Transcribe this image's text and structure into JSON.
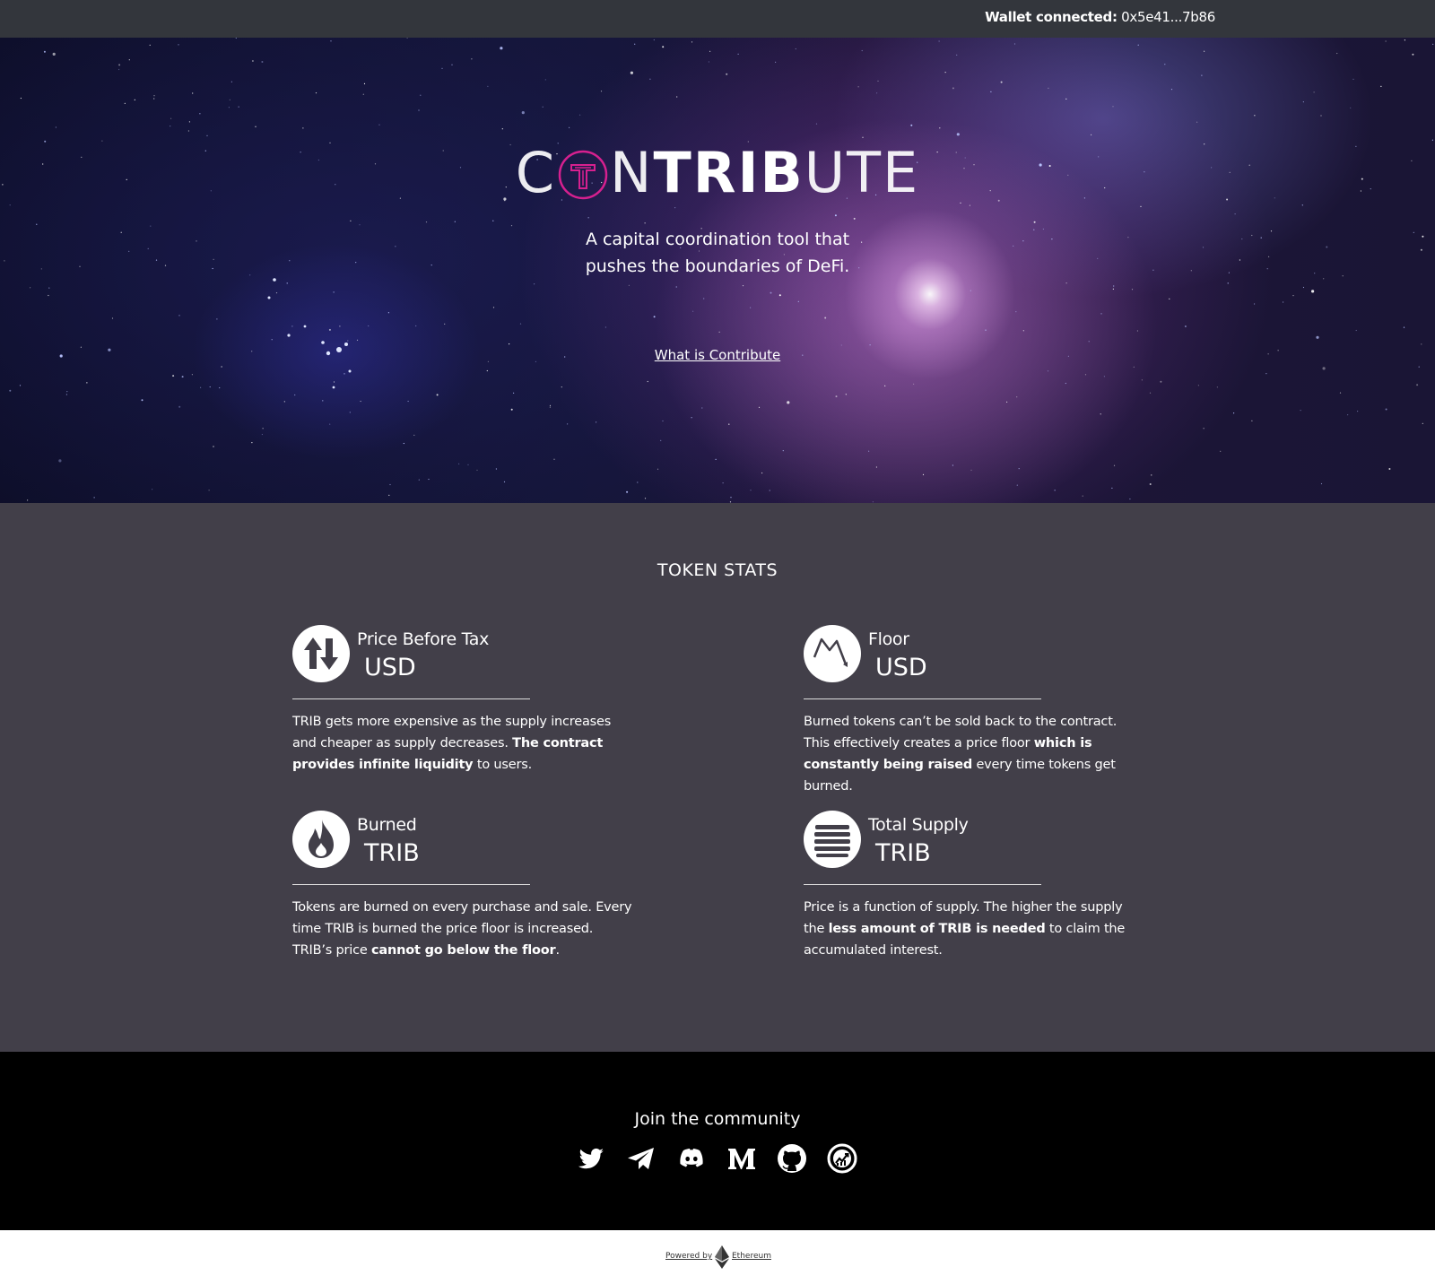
{
  "topbar": {
    "wallet_label": "Wallet connected:",
    "wallet_address": "0x5e41...7b86"
  },
  "hero": {
    "logo_left": "C",
    "logo_mid": "N",
    "logo_bold": "TRIB",
    "logo_right": "UTE",
    "tagline_line1": "A capital coordination tool that",
    "tagline_line2": "pushes the boundaries of DeFi.",
    "what_link": "What is Contribute",
    "accent_color": "#d6208f"
  },
  "stats": {
    "title": "TOKEN STATS",
    "items": [
      {
        "icon": "arrows-up-down-icon",
        "label": "Price Before Tax",
        "unit": "USD",
        "desc_a": "TRIB gets more expensive as the supply increases and cheaper as supply decreases. ",
        "desc_b": "The contract provides infinite liquidity",
        "desc_c": " to users."
      },
      {
        "icon": "price-floor-chart-icon",
        "label": "Floor",
        "unit": "USD",
        "desc_a": "Burned tokens can’t be sold back to the contract. This effectively creates a price floor ",
        "desc_b": "which is constantly being raised",
        "desc_c": " every time tokens get burned."
      },
      {
        "icon": "flame-icon",
        "label": "Burned",
        "unit": "TRIB",
        "desc_a": "Tokens are burned on every purchase and sale. Every time TRIB is burned the price floor is increased. TRIB’s price ",
        "desc_b": "cannot go below the floor",
        "desc_c": "."
      },
      {
        "icon": "stack-lines-icon",
        "label": "Total Supply",
        "unit": "TRIB",
        "desc_a": "Price is a function of supply. The higher the supply the ",
        "desc_b": "less amount of TRIB is needed",
        "desc_c": " to claim the accumulated interest."
      }
    ]
  },
  "community": {
    "title": "Join the community",
    "socials": [
      "twitter-icon",
      "telegram-icon",
      "discord-icon",
      "medium-icon",
      "github-icon",
      "coingecko-chart-icon"
    ]
  },
  "footer": {
    "powered_by": "Powered by",
    "ethereum": "Ethereum"
  }
}
